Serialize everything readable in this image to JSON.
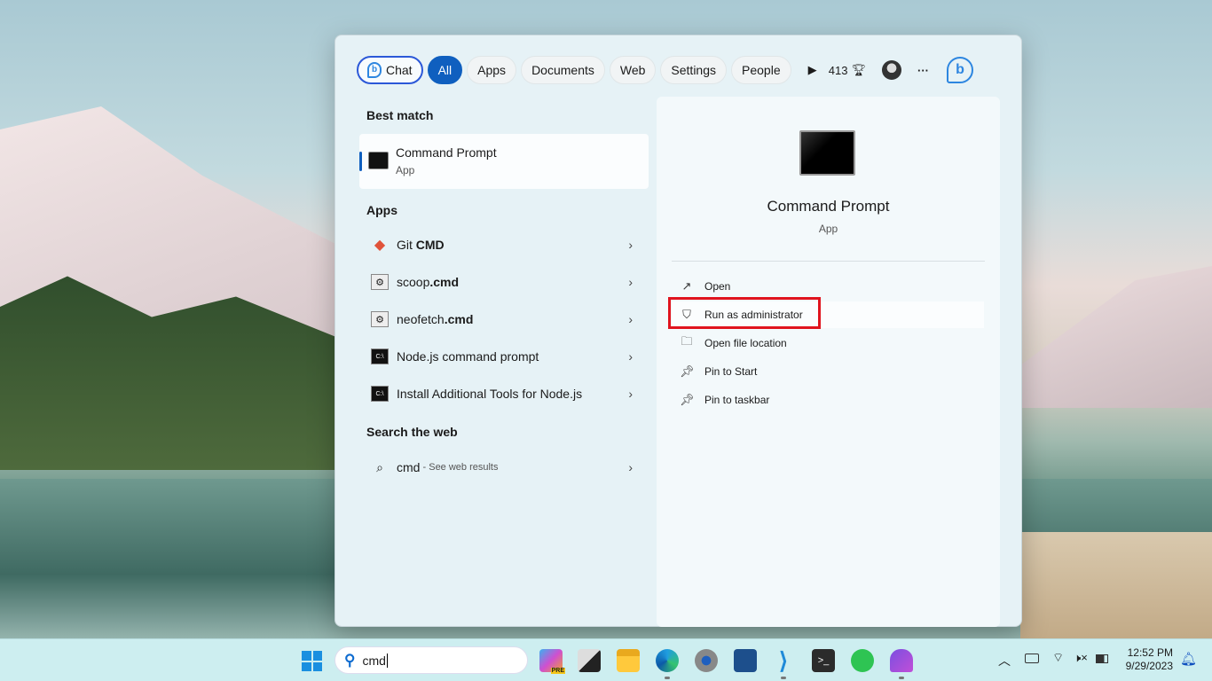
{
  "filters": {
    "chat": "Chat",
    "all": "All",
    "apps": "Apps",
    "documents": "Documents",
    "web": "Web",
    "settings": "Settings",
    "people": "People",
    "points": "413"
  },
  "best_match": {
    "heading": "Best match",
    "name": "Command Prompt",
    "type": "App"
  },
  "apps": {
    "heading": "Apps",
    "items": [
      {
        "pre": "Git ",
        "bold": "CMD"
      },
      {
        "pre": "scoop",
        "bold": ".cmd"
      },
      {
        "pre": "neofetch",
        "bold": ".cmd"
      },
      {
        "pre": "Node.js command prompt",
        "bold": ""
      },
      {
        "pre": "Install Additional Tools for Node.js",
        "bold": ""
      }
    ]
  },
  "web": {
    "heading": "Search the web",
    "query": "cmd",
    "suffix": " - See web results"
  },
  "detail": {
    "title": "Command Prompt",
    "type": "App",
    "actions": [
      "Open",
      "Run as administrator",
      "Open file location",
      "Pin to Start",
      "Pin to taskbar"
    ]
  },
  "taskbar": {
    "search_value": "cmd",
    "time": "12:52 PM",
    "date": "9/29/2023",
    "copilot_badge": "PRE"
  },
  "colors": {
    "accent": "#0f5fbf",
    "highlight": "#e0141e"
  }
}
